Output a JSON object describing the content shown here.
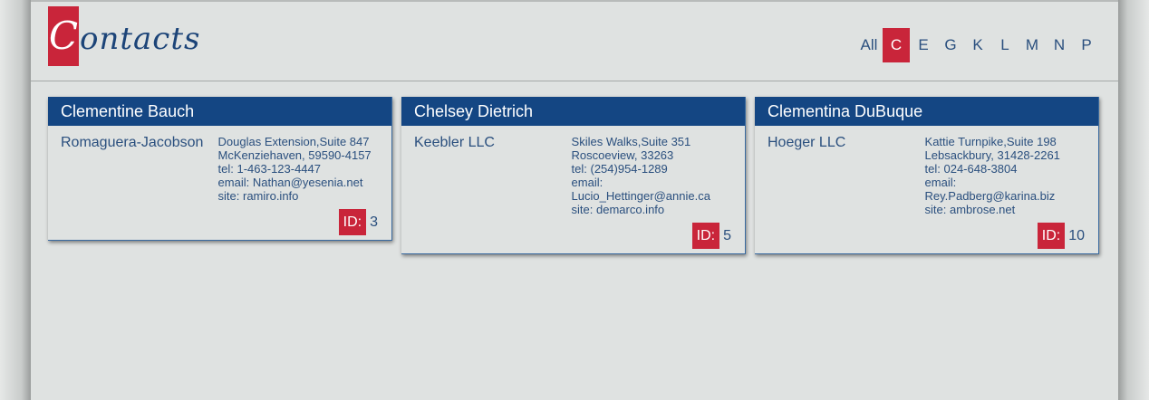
{
  "header": {
    "logo_initial": "C",
    "logo_rest": "ontacts"
  },
  "letters": [
    {
      "label": "All",
      "active": false
    },
    {
      "label": "C",
      "active": true
    },
    {
      "label": "E",
      "active": false
    },
    {
      "label": "G",
      "active": false
    },
    {
      "label": "K",
      "active": false
    },
    {
      "label": "L",
      "active": false
    },
    {
      "label": "M",
      "active": false
    },
    {
      "label": "N",
      "active": false
    },
    {
      "label": "P",
      "active": false
    }
  ],
  "contacts": [
    {
      "name": "Clementine Bauch",
      "company": "Romaguera-Jacobson",
      "address1": "Douglas Extension,Suite 847",
      "address2": "McKenziehaven, 59590-4157",
      "tel": "tel: 1-463-123-4447",
      "email_label": "",
      "email": "email: Nathan@yesenia.net",
      "site": "site: ramiro.info",
      "id_label": "ID:",
      "id": "3"
    },
    {
      "name": "Chelsey Dietrich",
      "company": "Keebler LLC",
      "address1": "Skiles Walks,Suite 351",
      "address2": "Roscoeview, 33263",
      "tel": "tel: (254)954-1289",
      "email_label": "email:",
      "email": "Lucio_Hettinger@annie.ca",
      "site": "site: demarco.info",
      "id_label": "ID:",
      "id": "5"
    },
    {
      "name": "Clementina DuBuque",
      "company": "Hoeger LLC",
      "address1": "Kattie Turnpike,Suite 198",
      "address2": "Lebsackbury, 31428-2261",
      "tel": "tel: 024-648-3804",
      "email_label": "email:",
      "email": "Rey.Padberg@karina.biz",
      "site": "site: ambrose.net",
      "id_label": "ID:",
      "id": "10"
    }
  ],
  "colors": {
    "accent_red": "#c9253a",
    "header_blue": "#144683",
    "text_blue": "#2a4f7e",
    "background": "#dfe2e1"
  }
}
